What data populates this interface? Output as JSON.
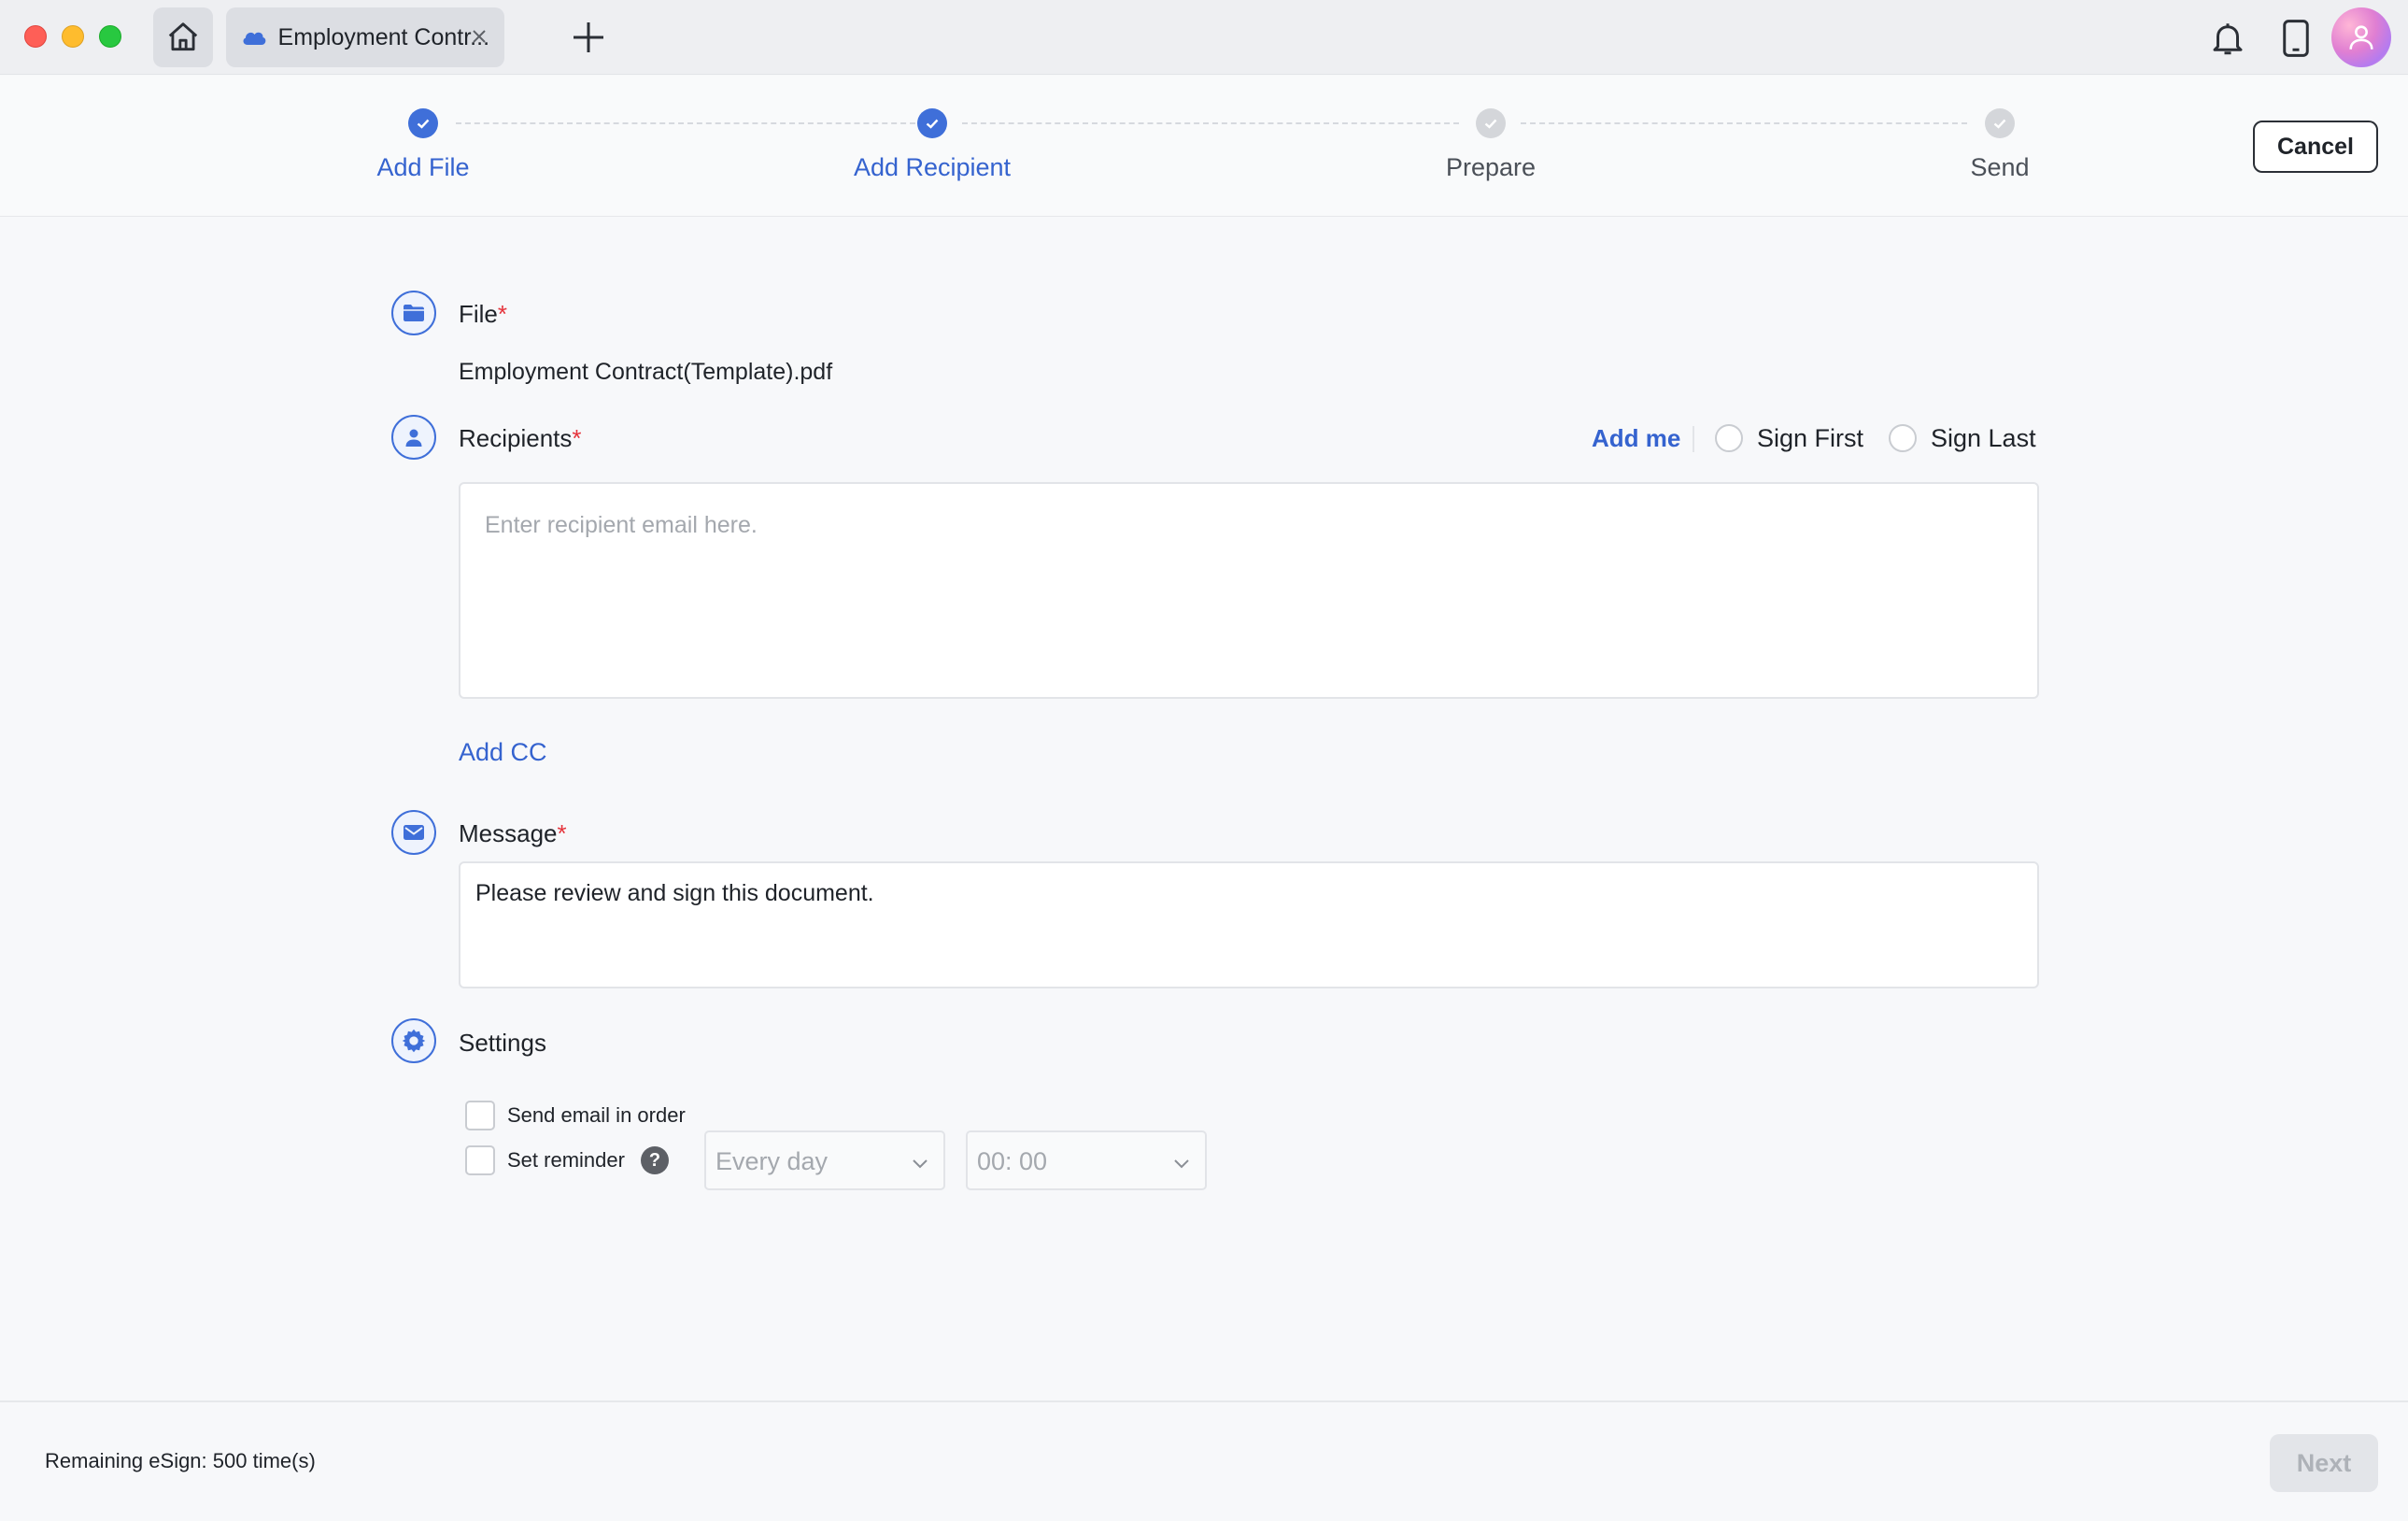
{
  "window": {
    "tab_title": "Employment Contr...",
    "icons": [
      "home-icon",
      "cloud-icon",
      "close-icon",
      "plus-icon",
      "bell-icon",
      "tablet-icon",
      "avatar"
    ]
  },
  "stepper": {
    "steps": [
      {
        "label": "Add File",
        "state": "done"
      },
      {
        "label": "Add Recipient",
        "state": "done"
      },
      {
        "label": "Prepare",
        "state": "todo"
      },
      {
        "label": "Send",
        "state": "todo"
      }
    ],
    "cancel_label": "Cancel"
  },
  "file": {
    "title": "File",
    "required_mark": "*",
    "name": "Employment Contract(Template).pdf"
  },
  "recipients": {
    "title": "Recipients",
    "required_mark": "*",
    "add_me": "Add me",
    "sign_first": "Sign First",
    "sign_last": "Sign Last",
    "placeholder": "Enter recipient email here.",
    "add_cc": "Add CC"
  },
  "message": {
    "title": "Message",
    "required_mark": "*",
    "value": "Please review and sign this document."
  },
  "settings": {
    "title": "Settings",
    "send_in_order": "Send email in order",
    "set_reminder": "Set reminder",
    "help": "?",
    "frequency": "Every day",
    "time": "00: 00"
  },
  "footer": {
    "remaining": "Remaining eSign: 500 time(s)",
    "next_label": "Next"
  },
  "colors": {
    "accent": "#3f6fd9",
    "link": "#3563cf",
    "required": "#e5333b"
  }
}
